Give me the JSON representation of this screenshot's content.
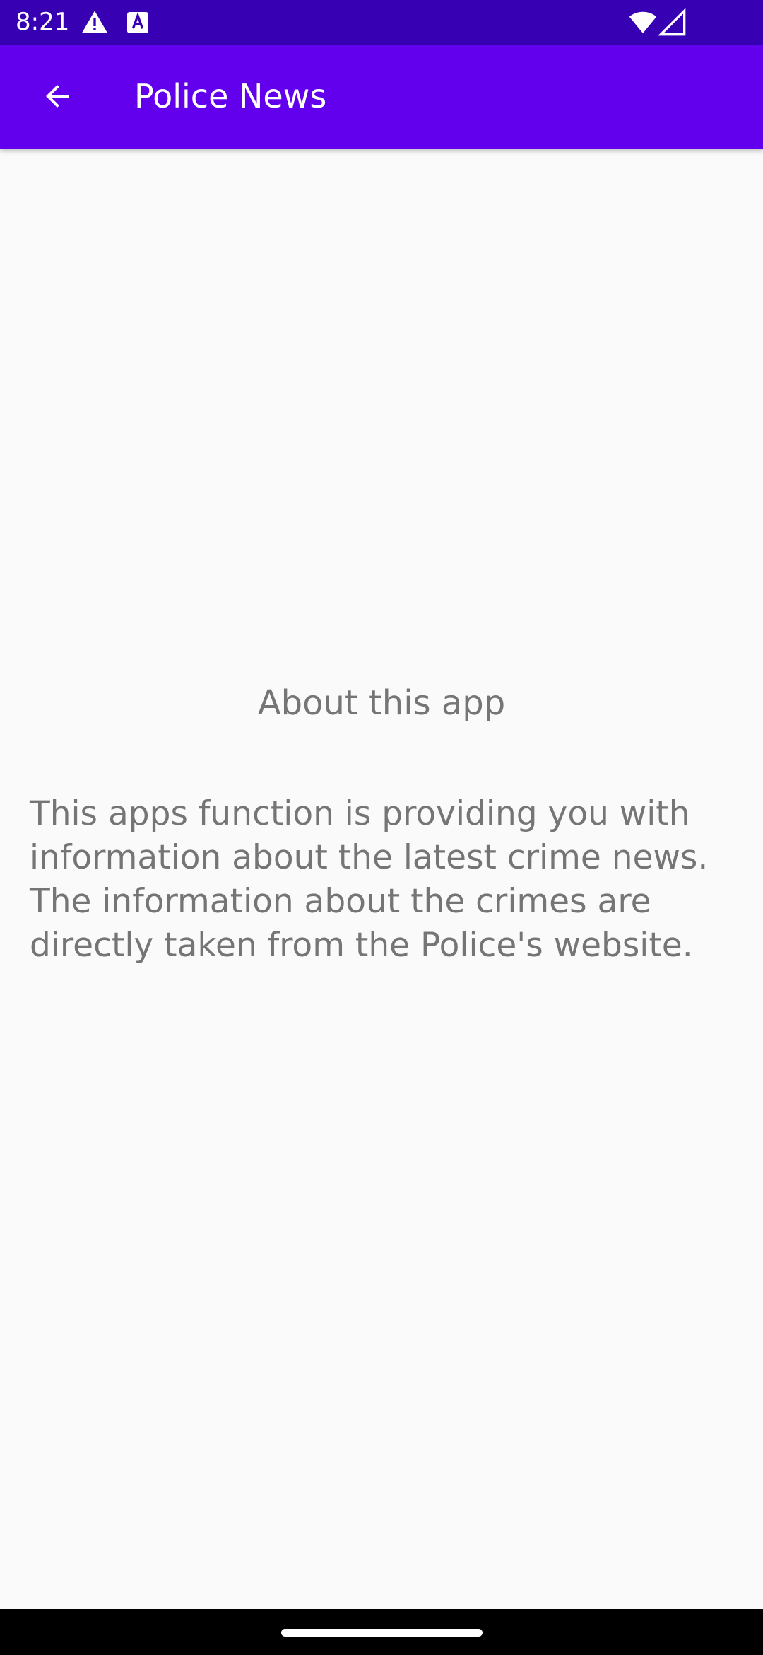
{
  "status_bar": {
    "time": "8:21",
    "icons": [
      "alert-icon",
      "accessibility-a-icon",
      "wifi-icon",
      "cellular-signal-icon"
    ]
  },
  "app_bar": {
    "title": "Police News",
    "back_icon": "arrow-back-icon"
  },
  "about": {
    "title": "About this app",
    "body": "This apps function is providing you with information about the latest crime news. The information about the crimes are directly taken from the Police's website."
  },
  "colors": {
    "status_bar": "#3700b3",
    "app_bar": "#6200ee",
    "background": "#fafafa",
    "text": "#757575"
  }
}
